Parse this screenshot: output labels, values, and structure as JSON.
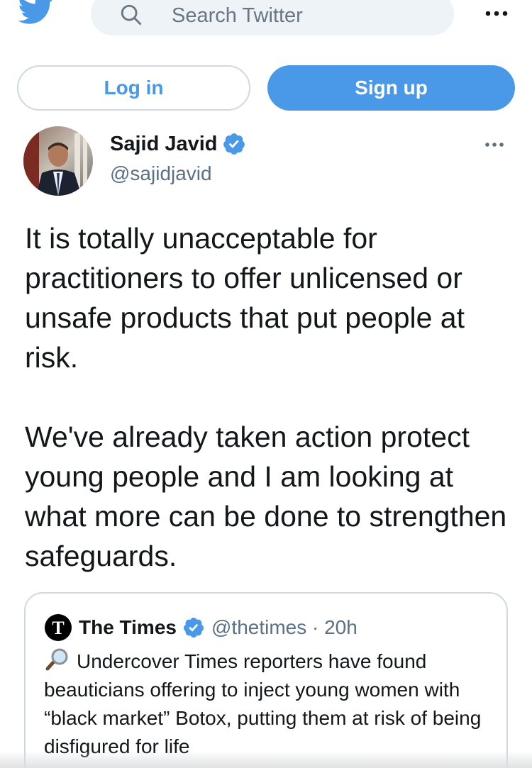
{
  "search": {
    "placeholder": "Search Twitter"
  },
  "auth": {
    "login_label": "Log in",
    "signup_label": "Sign up"
  },
  "author": {
    "name": "Sajid Javid",
    "handle": "@sajidjavid",
    "verified": true
  },
  "tweet": {
    "paragraphs": [
      "It is totally unacceptable for practitioners to offer unlicensed or unsafe products that put people at risk.",
      "We've already taken action protect young people and I am looking at what more can be done to strengthen safeguards."
    ]
  },
  "quoted": {
    "name": "The Times",
    "handle_time": "@thetimes · 20h",
    "text": "Undercover Times reporters have found beauticians offering to inject young women with “black market” Botox, putting them at risk of being disfigured for life"
  },
  "icons": {
    "logo": "twitter-bird-icon",
    "search": "search-icon",
    "more": "more-horizontal-icon",
    "verified": "verified-badge-icon",
    "lens": "magnifying-glass-emoji"
  },
  "colors": {
    "accent": "#4a99e9",
    "secondary_text": "#5b7083",
    "border": "#cfd9de",
    "search_bg": "#eef3f7"
  }
}
